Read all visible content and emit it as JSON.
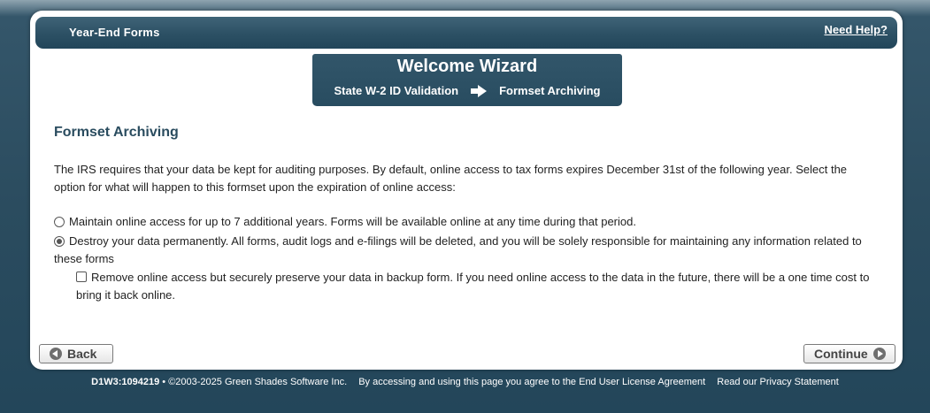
{
  "header": {
    "title": "Year-End Forms",
    "help_link": "Need Help?"
  },
  "wizard": {
    "title": "Welcome Wizard",
    "steps": [
      "State W-2 ID Validation",
      "Formset Archiving"
    ],
    "arrow_icon": "right-arrow-icon"
  },
  "main": {
    "section_title": "Formset Archiving",
    "intro": "The IRS requires that your data be kept for auditing purposes. By default, online access to tax forms expires December 31st of the following year. Select the option for what will happen to this formset upon the expiration of online access:",
    "options": [
      {
        "label": "Maintain online access for up to 7 additional years. Forms will be available online at any time during that period.",
        "type": "radio",
        "checked": false
      },
      {
        "label": "Destroy your data permanently. All forms, audit logs and e-filings will be deleted, and you will be solely responsible for maintaining any information related to these forms",
        "type": "radio",
        "checked": true
      },
      {
        "label": "Remove online access but securely preserve your data in backup form. If you need online access to the data in the future, there will be a one time cost to bring it back online.",
        "type": "checkbox",
        "checked": false
      }
    ]
  },
  "buttons": {
    "back": "Back",
    "continue": "Continue"
  },
  "footer": {
    "build": "D1W3:1094219",
    "copyright": "• ©2003-2025 Green Shades Software Inc.",
    "agreement": "By accessing and using this page you agree to the End User License Agreement",
    "privacy": "Read our Privacy Statement"
  },
  "colors": {
    "header_bg": "#2c5064",
    "title_text": "#2a4c5f",
    "background": "#2b4c5f"
  }
}
